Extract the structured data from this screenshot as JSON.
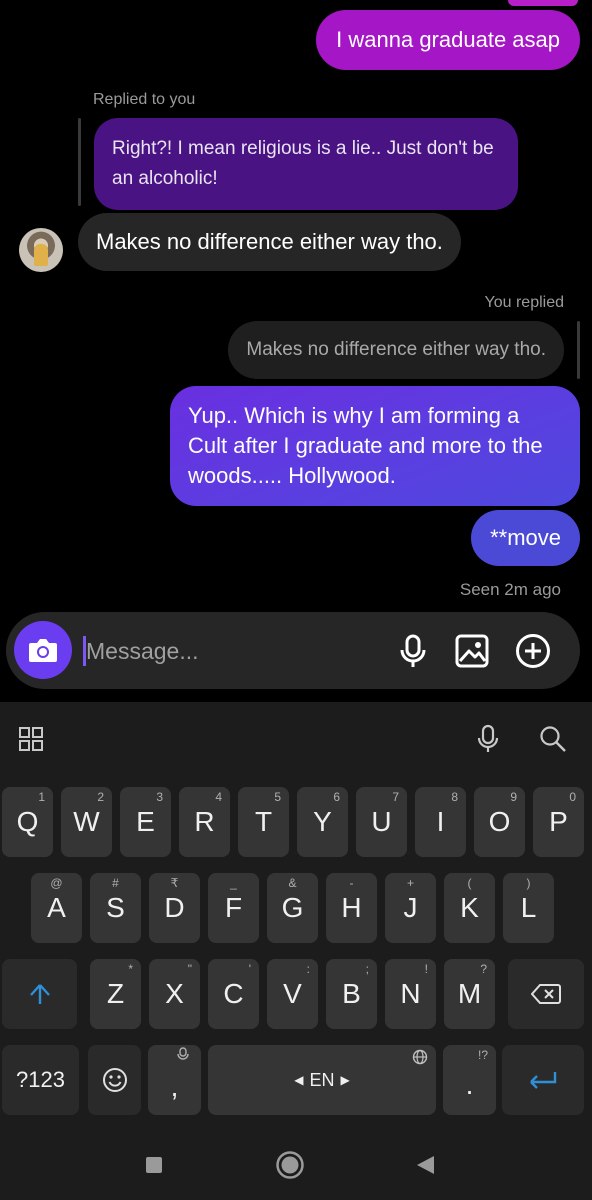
{
  "chat": {
    "messages": [
      {
        "id": "m1",
        "text": "I wanna graduate asap"
      },
      {
        "id": "m2_label",
        "text": "Replied to you"
      },
      {
        "id": "m2",
        "text": "Right?! I mean religious is a lie.. Just don't be an alcoholic!"
      },
      {
        "id": "m3",
        "text": "Makes no difference either way tho."
      },
      {
        "id": "m4_label",
        "text": "You replied"
      },
      {
        "id": "m4",
        "text": "Makes no difference either way tho."
      },
      {
        "id": "m5",
        "text": "Yup.. Which is why I am forming a Cult after I graduate and more to the woods..... Hollywood."
      },
      {
        "id": "m6",
        "text": "**move"
      }
    ],
    "seen_status": "Seen 2m ago"
  },
  "composer": {
    "placeholder": "Message..."
  },
  "keyboard": {
    "row1": [
      {
        "key": "Q",
        "hint": "1"
      },
      {
        "key": "W",
        "hint": "2"
      },
      {
        "key": "E",
        "hint": "3"
      },
      {
        "key": "R",
        "hint": "4"
      },
      {
        "key": "T",
        "hint": "5"
      },
      {
        "key": "Y",
        "hint": "6"
      },
      {
        "key": "U",
        "hint": "7"
      },
      {
        "key": "I",
        "hint": "8"
      },
      {
        "key": "O",
        "hint": "9"
      },
      {
        "key": "P",
        "hint": "0"
      }
    ],
    "row2": [
      {
        "key": "A",
        "hint": "@"
      },
      {
        "key": "S",
        "hint": "#"
      },
      {
        "key": "D",
        "hint": "₹"
      },
      {
        "key": "F",
        "hint": "_"
      },
      {
        "key": "G",
        "hint": "&"
      },
      {
        "key": "H",
        "hint": "-"
      },
      {
        "key": "J",
        "hint": "+"
      },
      {
        "key": "K",
        "hint": "("
      },
      {
        "key": "L",
        "hint": ")"
      }
    ],
    "row3": [
      {
        "key": "Z",
        "hint": "*"
      },
      {
        "key": "X",
        "hint": "\""
      },
      {
        "key": "C",
        "hint": "'"
      },
      {
        "key": "V",
        "hint": ":"
      },
      {
        "key": "B",
        "hint": ";"
      },
      {
        "key": "N",
        "hint": "!"
      },
      {
        "key": "M",
        "hint": "?"
      }
    ],
    "symbols_key": "?123",
    "comma_key": ",",
    "space_label": "EN",
    "period_key": ".",
    "period_hint": "!?",
    "accent_color": "#2f8fd8"
  },
  "colors": {
    "sent_magenta": "#a516c6",
    "sent_purple": "#6a2fe0",
    "received_gray": "#262626",
    "camera_button": "#6b3df0"
  },
  "icons": {
    "apps": "apps-grid-icon",
    "mic_toolbar": "microphone-icon",
    "search": "search-icon",
    "shift": "shift-arrow-icon",
    "backspace": "backspace-icon",
    "emoji": "emoji-icon",
    "globe": "globe-icon",
    "enter": "enter-icon"
  }
}
